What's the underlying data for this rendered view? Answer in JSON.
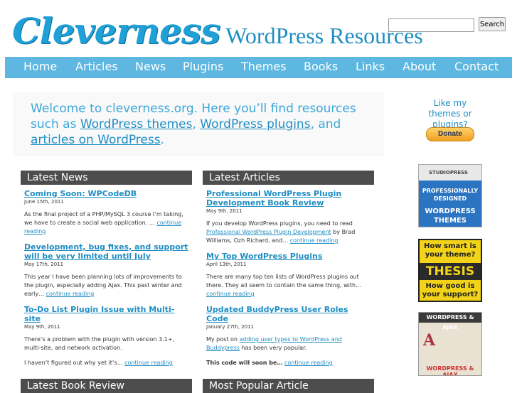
{
  "header": {
    "logo_script": "Cleverness",
    "logo_subtitle": "WordPress Resources",
    "search_placeholder": "",
    "search_button": "Search"
  },
  "nav": [
    "Home",
    "Articles",
    "News",
    "Plugins",
    "Themes",
    "Books",
    "Links",
    "About",
    "Contact"
  ],
  "welcome": {
    "intro": "Welcome to cleverness.org. Here you’ll find resources such as ",
    "link1": "WordPress themes",
    "sep1": ", ",
    "link2": "WordPress plugins",
    "sep2": ", and ",
    "link3": "articles on WordPress",
    "end": "."
  },
  "latest_news": {
    "heading": "Latest News",
    "posts": [
      {
        "title": "Coming Soon: WPCodeDB",
        "date": "June 15th, 2011",
        "text": "As the final project of a PHP/MySQL 3 course I’m taking, we have to create a social web application. …",
        "more": "continue reading"
      },
      {
        "title": "Development, bug fixes, and support will be very limited until July",
        "date": "May 17th, 2011",
        "text": "This year I have been planning lots of improvements to the plugin, especially adding Ajax. This past winter and early…",
        "more": "continue reading"
      },
      {
        "title": "To-Do List Plugin Issue with Multi-site",
        "date": "May 9th, 2011",
        "text": "There’s a problem with the plugin with version 3.1+, multi-site, and network activation.",
        "text2": "I haven’t figured out why yet it’s…",
        "more": "continue reading"
      }
    ]
  },
  "latest_articles": {
    "heading": "Latest Articles",
    "posts": [
      {
        "title": "Professional WordPress Plugin Development Book Review",
        "date": "May 9th, 2011",
        "text_a": "If you develop WordPress plugins, you need to read ",
        "link": "Professional WordPress Plugin Development",
        "text_b": " by Brad Williams, Ozh Richard, and…",
        "more": "continue reading"
      },
      {
        "title": "My Top WordPress Plugins",
        "date": "April 13th, 2011",
        "text": "There are many top ten lists of WordPress plugins out there. They all seem to contain the same thing, with…",
        "more": "continue reading"
      },
      {
        "title": "Updated BuddyPress User Roles Code",
        "date": "January 27th, 2011",
        "text_a": "My post on ",
        "link": "adding user types to WordPress and Buddypress",
        "text_b": " has been very popular.",
        "bold": "This code will soon be…",
        "more": "continue reading"
      }
    ]
  },
  "bottom_headings": [
    "Latest Book Review",
    "Most Popular Article"
  ],
  "sidebar": {
    "prompt": "Like my themes or plugins?",
    "donate": "Donate",
    "ad1": {
      "brand": "STUDIOPRESS",
      "line1": "PROFESSIONALLY DESIGNED",
      "line2": "WORDPRESS THEMES"
    },
    "ad2": {
      "q1": "How smart is your theme?",
      "name": "THESIS",
      "q2": "How good is your support?"
    },
    "ad3": {
      "top": "WORDPRESS & AJAX",
      "letter": "A",
      "bottom": "WORDPRESS & AJAX"
    }
  }
}
